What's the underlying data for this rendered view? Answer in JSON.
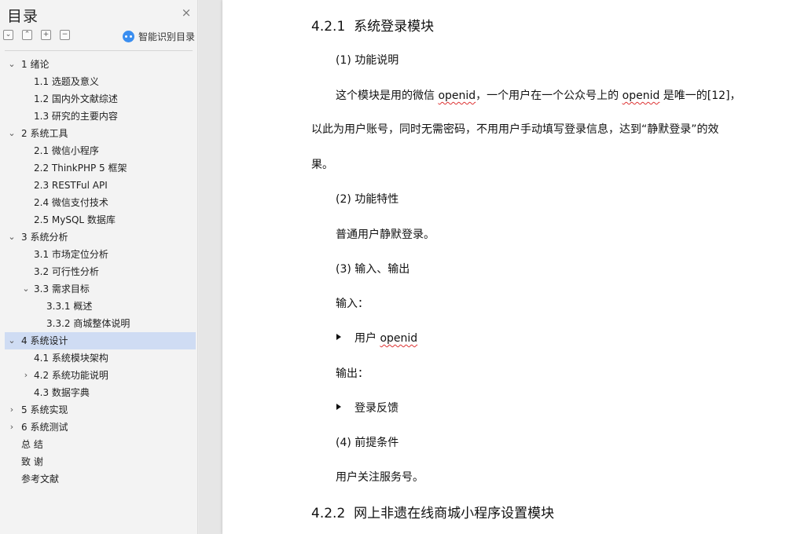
{
  "sidebar": {
    "title": "目录",
    "close_icon": "×",
    "toolbar": {
      "collapse_all": "⌄",
      "expand_all": "⌃",
      "add": "+",
      "remove": "−"
    },
    "ai_label": "智能识别目录",
    "items": [
      {
        "label": "1  绪论"
      },
      {
        "label": "1.1  选题及意义"
      },
      {
        "label": "1.2  国内外文献综述"
      },
      {
        "label": "1.3  研究的主要内容"
      },
      {
        "label": "2  系统工具"
      },
      {
        "label": "2.1  微信小程序"
      },
      {
        "label": "2.2 ThinkPHP 5  框架"
      },
      {
        "label": "2.3 RESTFul API"
      },
      {
        "label": "2.4  微信支付技术"
      },
      {
        "label": "2.5 MySQL 数据库"
      },
      {
        "label": "3  系统分析"
      },
      {
        "label": "3.1  市场定位分析"
      },
      {
        "label": "3.2  可行性分析"
      },
      {
        "label": "3.3  需求目标"
      },
      {
        "label": "3.3.1  概述"
      },
      {
        "label": "3.3.2  商城整体说明"
      },
      {
        "label": "4  系统设计"
      },
      {
        "label": "4.1 系统模块架构"
      },
      {
        "label": "4.2 系统功能说明"
      },
      {
        "label": "4.3  数据字典"
      },
      {
        "label": "5  系统实现"
      },
      {
        "label": "6  系统测试"
      },
      {
        "label": "总    结"
      },
      {
        "label": "致    谢"
      },
      {
        "label": "参考文献"
      }
    ]
  },
  "document": {
    "h_421_num": "4.2.1",
    "h_421_title": "系统登录模块",
    "s1": "(1)  功能说明",
    "p1_a": "这个模块是用的微信 ",
    "p1_b": "openid",
    "p1_c": "，一个用户在一个公众号上的 ",
    "p1_d": "openid",
    "p1_e": " 是唯一的[12]，",
    "p2": "以此为用户账号，同时无需密码，不用用户手动填写登录信息，达到“静默登录”的效",
    "p3": "果。",
    "s2": "(2)  功能特性",
    "p4": "普通用户静默登录。",
    "s3": "(3)  输入、输出",
    "p5": "输入：",
    "b1_a": "用户 ",
    "b1_b": "openid",
    "p6": "输出：",
    "b2": "登录反馈",
    "s4": "(4)  前提条件",
    "p7": "用户关注服务号。",
    "h_422_num": "4.2.2",
    "h_422_title": "网上非遗在线商城小程序设置模块"
  }
}
